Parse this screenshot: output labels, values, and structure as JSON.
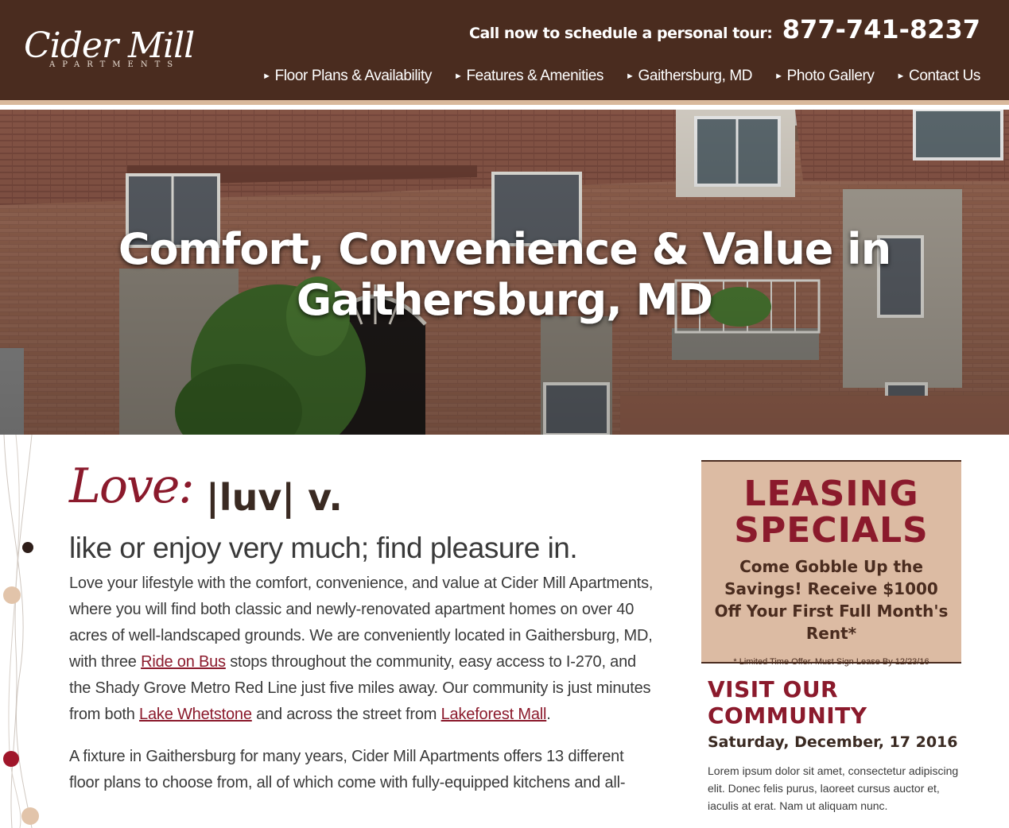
{
  "header": {
    "logo_main": "Cider Mill",
    "logo_sub": "APARTMENTS",
    "call_label": "Call now to schedule a personal tour:",
    "phone": "877-741-8237",
    "nav": [
      {
        "label": "Floor Plans & Availability"
      },
      {
        "label": "Features & Amenities"
      },
      {
        "label": "Gaithersburg, MD"
      },
      {
        "label": "Photo Gallery"
      },
      {
        "label": "Contact Us"
      }
    ],
    "nav_arrow": "►"
  },
  "hero": {
    "title_line1": "Comfort, Convenience & Value in",
    "title_line2": "Gaithersburg, MD"
  },
  "main": {
    "love_word": "Love:",
    "love_def": "|luv| v.",
    "tagline": "like or enjoy very much; find pleasure in.",
    "para1": {
      "t1": "Love your lifestyle with the comfort, convenience, and value at Cider Mill Apartments, where you will find both classic and newly-renovated apartment homes on over 40 acres of well-landscaped grounds. We are conveniently located in Gaithersburg, MD, with three ",
      "link1": "Ride on Bus",
      "t2": " stops throughout the community, easy access to I-270, and the Shady Grove Metro Red Line just five miles away. Our community is just minutes from both ",
      "link2": "Lake Whetstone",
      "t3": " and across the street from ",
      "link3": "Lakeforest Mall",
      "t4": "."
    },
    "para2": "A fixture in Gaithersburg for many years, Cider Mill Apartments offers 13 different floor plans to choose from, all of which come with fully-equipped kitchens and all-"
  },
  "sidebar": {
    "specials_title_1": "LEASING",
    "specials_title_2": "SPECIALS",
    "specials_offer": "Come Gobble Up the Savings! Receive $1000 Off Your First Full Month's Rent*",
    "specials_fine": "* Limited Time Offer. Must Sign Lease By 12/23/16",
    "visit_title_1": "VISIT OUR",
    "visit_title_2": "COMMUNITY",
    "visit_date": "Saturday, December, 17 2016",
    "visit_body": "Lorem ipsum dolor sit amet, consectetur adipiscing elit. Donec felis purus, laoreet cursus auctor et, iaculis at erat. Nam ut aliquam nunc."
  },
  "colors": {
    "header_bg": "#4a2c1f",
    "accent_maroon": "#8b1a2c",
    "tan": "#dcbba3"
  }
}
